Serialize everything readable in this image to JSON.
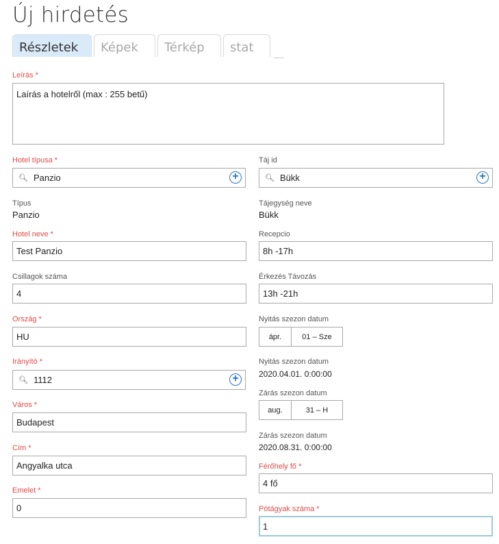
{
  "page": {
    "title": "Új hirdetés"
  },
  "tabs": [
    {
      "label": "Részletek"
    },
    {
      "label": "Képek"
    },
    {
      "label": "Térkép"
    },
    {
      "label": "stat"
    }
  ],
  "fields": {
    "leiras": {
      "label": "Leírás *",
      "value": "Laírás a hotelről (max : 255 betű)"
    },
    "hotel_tipusa": {
      "label": "Hotel típusa *",
      "value": "Panzio"
    },
    "taj_id": {
      "label": "Táj id",
      "value": "Bükk"
    },
    "tipus": {
      "label": "Típus",
      "value": "Panzio"
    },
    "tajegyseg_neve": {
      "label": "Tájegység neve",
      "value": "Bükk"
    },
    "hotel_neve": {
      "label": "Hotel neve *",
      "value": "Test Panzio"
    },
    "recepcio": {
      "label": "Recepcio",
      "value": "8h -17h"
    },
    "csillagok": {
      "label": "Csillagok száma",
      "value": "4"
    },
    "erkezes": {
      "label": "Érkezés Távozás",
      "value": "13h -21h"
    },
    "orszag": {
      "label": "Ország *",
      "value": "HU"
    },
    "nyitas_date": {
      "label": "Nyitás szezon datum",
      "month": "ápr.",
      "day": "01 – Sze"
    },
    "iranyito": {
      "label": "Irányító *",
      "value": "1112"
    },
    "nyitas_text": {
      "label": "Nyitás szezon datum",
      "value": "2020.04.01. 0:00:00"
    },
    "varos": {
      "label": "Város *",
      "value": "Budapest"
    },
    "zaras_date": {
      "label": "Zárás szezon datum",
      "month": "aug.",
      "day": "31 – H"
    },
    "cim": {
      "label": "Cím *",
      "value": "Angyalka utca"
    },
    "zaras_text": {
      "label": "Zárás szezon datum",
      "value": "2020.08.31. 0:00:00"
    },
    "emelet": {
      "label": "Emelet *",
      "value": "0"
    },
    "ferohely": {
      "label": "Férőhely fő *",
      "value": "4 fő"
    },
    "potagyak": {
      "label": "Pótágyak száma *",
      "value": "1"
    }
  },
  "icons": {
    "search": "search-icon",
    "add": "plus-circle-icon"
  },
  "colors": {
    "required_label": "#e04a48",
    "active_tab": "#daeaf8",
    "accent": "#2676c4"
  }
}
